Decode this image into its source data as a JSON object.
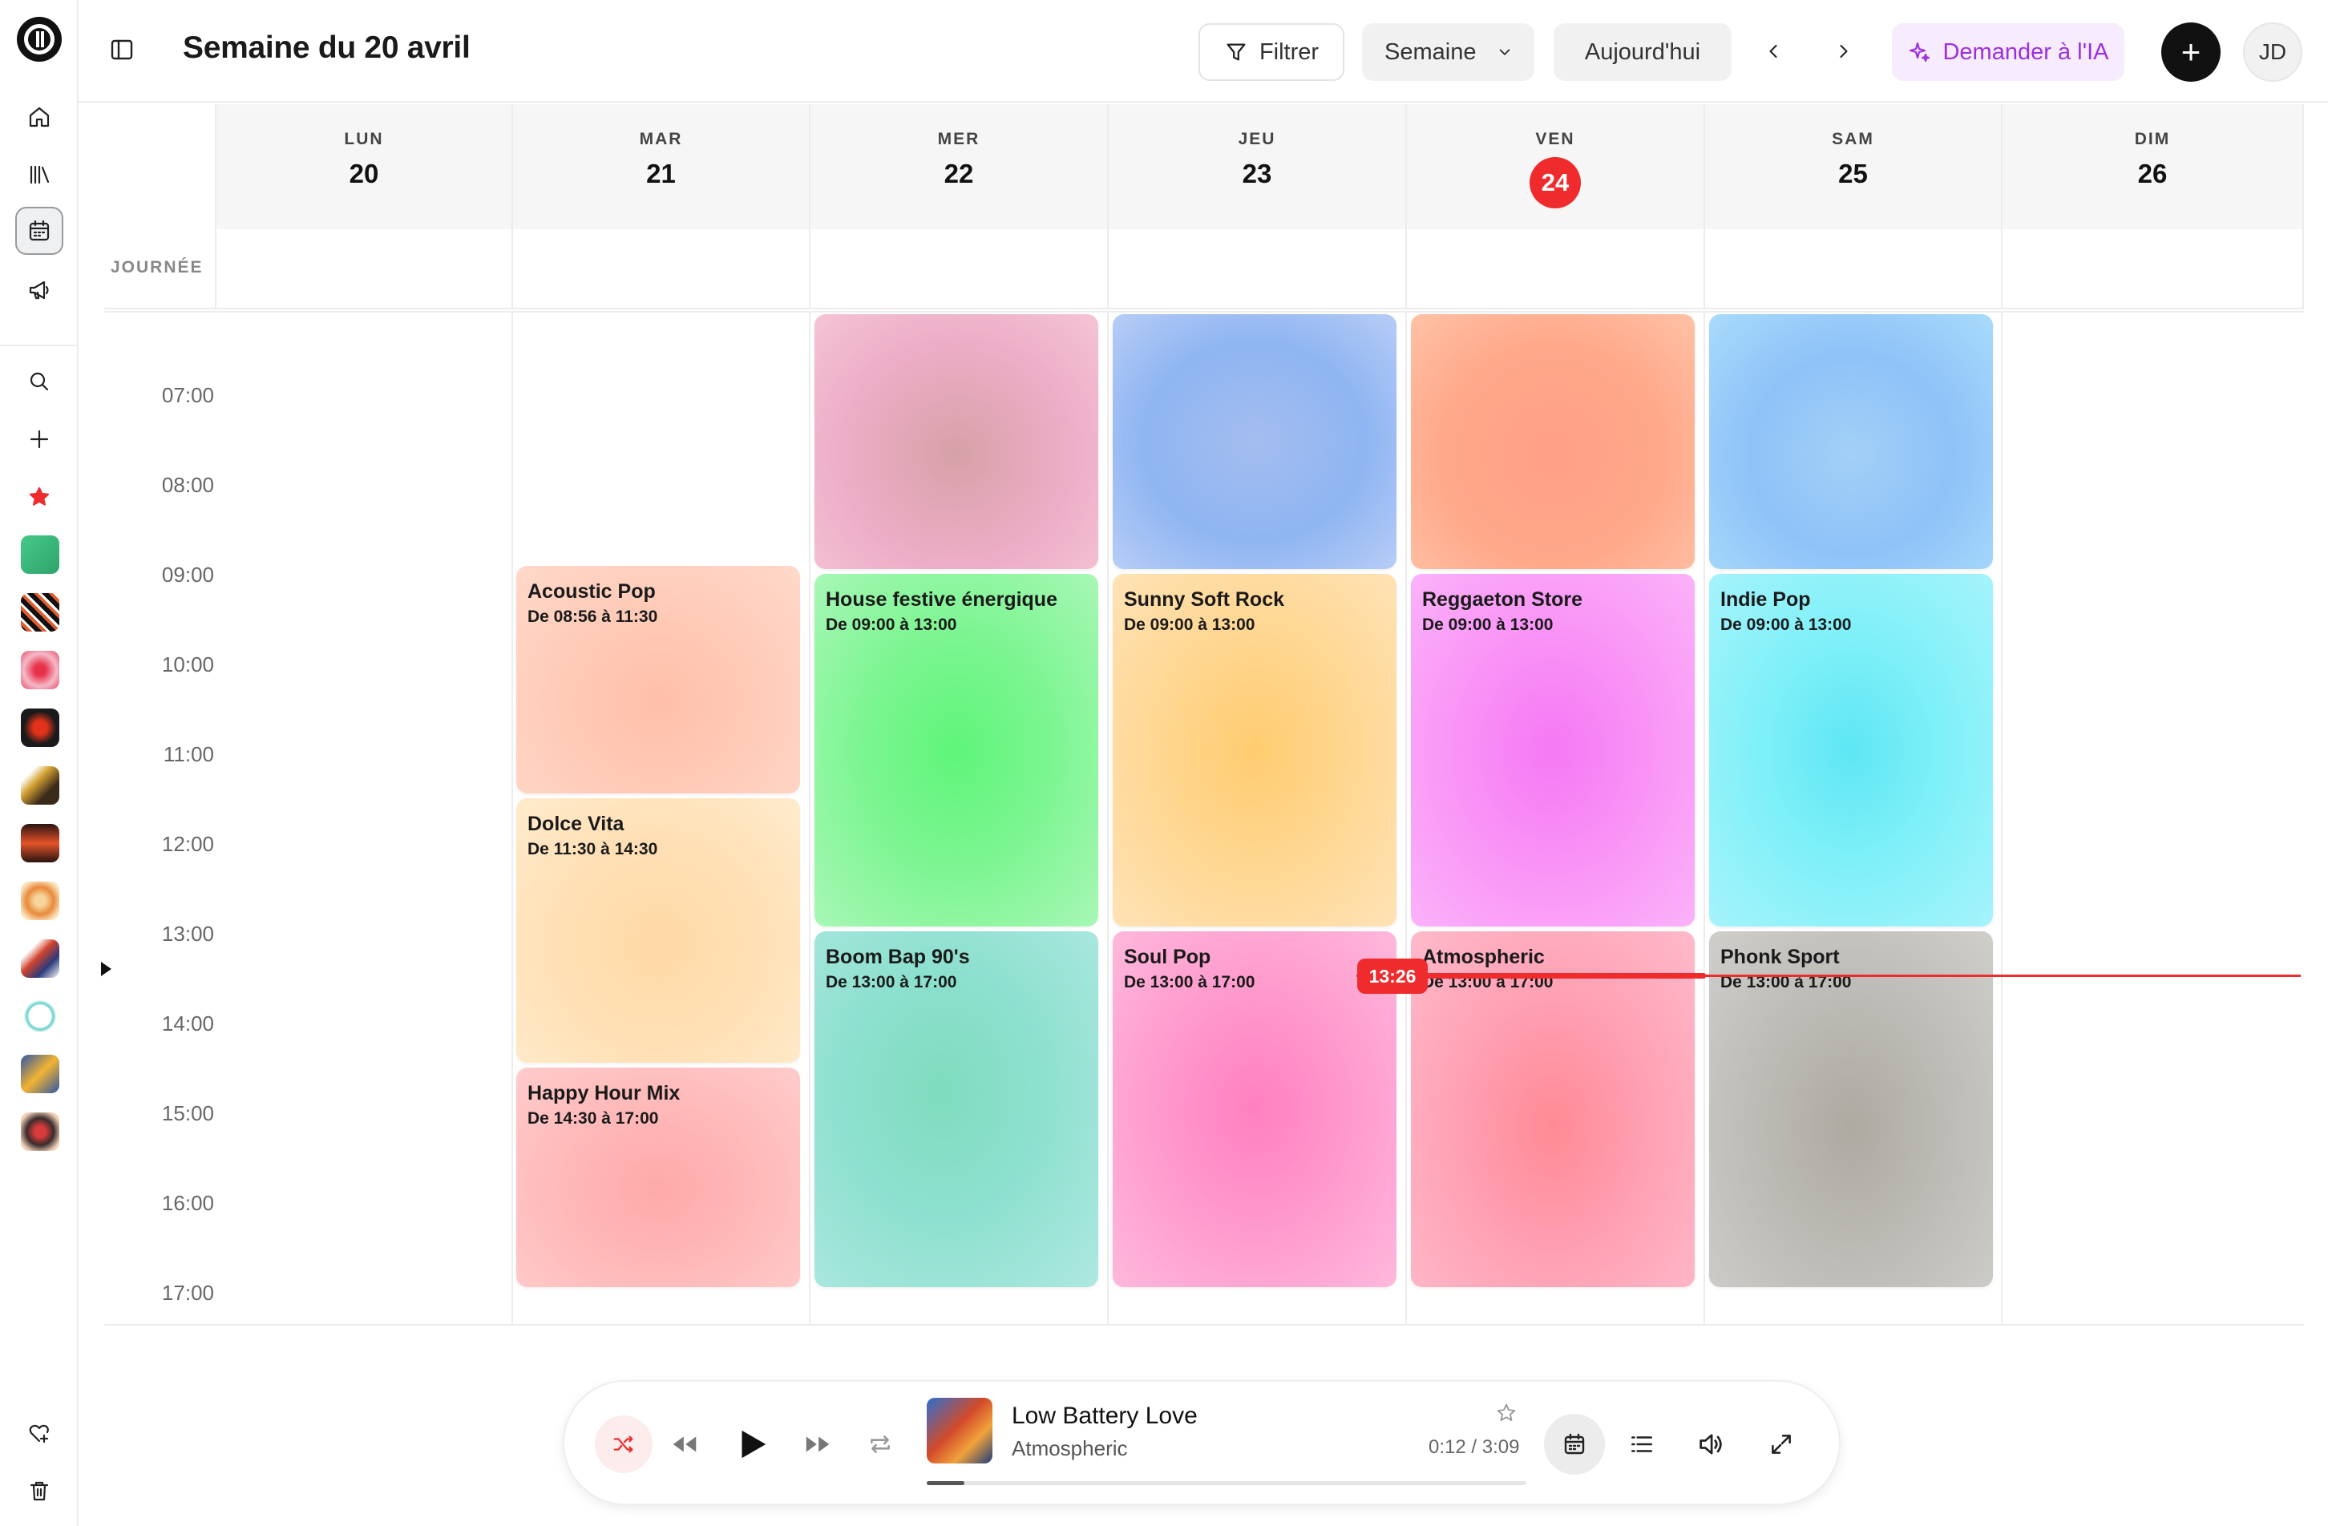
{
  "header": {
    "title": "Semaine du 20 avril",
    "filter_label": "Filtrer",
    "view_label": "Semaine",
    "today_label": "Aujourd'hui",
    "ai_label": "Demander à l'IA",
    "add_label": "+",
    "avatar_initials": "JD"
  },
  "calendar": {
    "allday_label": "JOURNÉE",
    "days": [
      {
        "name": "LUN",
        "date": "20"
      },
      {
        "name": "MAR",
        "date": "21"
      },
      {
        "name": "MER",
        "date": "22"
      },
      {
        "name": "JEU",
        "date": "23"
      },
      {
        "name": "VEN",
        "date": "24",
        "today": true
      },
      {
        "name": "SAM",
        "date": "25"
      },
      {
        "name": "DIM",
        "date": "26"
      }
    ],
    "hours": [
      "07:00",
      "08:00",
      "09:00",
      "10:00",
      "11:00",
      "12:00",
      "13:00",
      "14:00",
      "15:00",
      "16:00",
      "17:00"
    ],
    "now_time": "13:26",
    "events": {
      "wed_early": {
        "title": "",
        "subtitle": ""
      },
      "thu_early": {
        "title": "",
        "subtitle": ""
      },
      "fri_early": {
        "title": "",
        "subtitle": ""
      },
      "sat_early": {
        "title": "",
        "subtitle": ""
      },
      "acoustic_pop": {
        "title": "Acoustic Pop",
        "subtitle": "De 08:56 à 11:30"
      },
      "dolce_vita": {
        "title": "Dolce Vita",
        "subtitle": "De 11:30 à 14:30"
      },
      "happy_hour": {
        "title": "Happy Hour Mix",
        "subtitle": "De 14:30 à 17:00"
      },
      "house_festive": {
        "title": "House festive énergique",
        "subtitle": "De 09:00 à 13:00"
      },
      "boom_bap": {
        "title": "Boom Bap 90's",
        "subtitle": "De 13:00 à 17:00"
      },
      "sunny_soft_rock": {
        "title": "Sunny Soft Rock",
        "subtitle": "De 09:00 à 13:00"
      },
      "soul_pop": {
        "title": "Soul Pop",
        "subtitle": "De 13:00 à 17:00"
      },
      "reggaeton": {
        "title": "Reggaeton Store",
        "subtitle": "De 09:00 à 13:00"
      },
      "atmospheric": {
        "title": "Atmospheric",
        "subtitle": "De 13:00 à 17:00"
      },
      "indie_pop": {
        "title": "Indie Pop",
        "subtitle": "De 09:00 à 13:00"
      },
      "phonk_sport": {
        "title": "Phonk Sport",
        "subtitle": "De 13:00 à 17:00"
      }
    }
  },
  "player": {
    "track_title": "Low Battery Love",
    "track_artist": "Atmospheric",
    "time": "0:12 / 3:09",
    "progress_fraction": 0.063
  },
  "colors": {
    "accent_red": "#ef2b2d",
    "ai_purple": "#9b2fe0"
  },
  "icons": [
    "home-icon",
    "library-icon",
    "calendar-icon",
    "megaphone-icon",
    "search-icon",
    "plus-icon",
    "star-icon",
    "heart-plus-icon",
    "trash-icon",
    "filter-icon",
    "chevron-down-icon",
    "chevron-left-icon",
    "chevron-right-icon",
    "sparkles-icon",
    "shuffle-icon",
    "rewind-icon",
    "play-icon",
    "forward-icon",
    "repeat-icon",
    "list-icon",
    "volume-icon",
    "expand-icon",
    "sidebar-toggle-icon"
  ]
}
